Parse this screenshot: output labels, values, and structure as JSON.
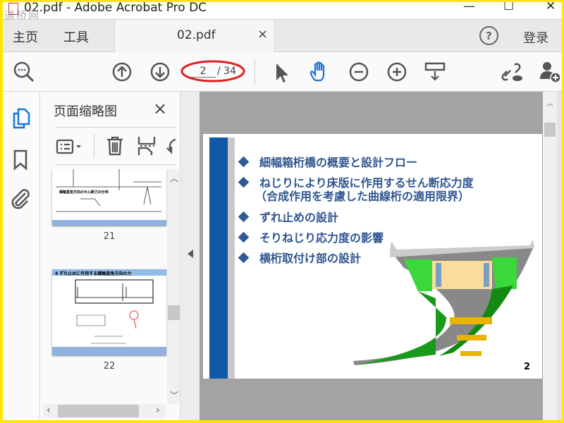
{
  "window": {
    "title": "02.pdf - Adobe Acrobat Pro DC",
    "watermark": "道桥网",
    "minimize": "—",
    "maximize": "☐",
    "close": "✕"
  },
  "tabs": {
    "home": "主页",
    "tools": "工具",
    "document": "02.pdf",
    "document_close": "×",
    "help": "?",
    "signin": "登录"
  },
  "toolbar": {
    "current_page": "2",
    "total_pages": "/ 34",
    "icons": [
      "zoom-search-icon",
      "page-up-icon",
      "page-down-icon",
      "select-arrow-icon",
      "hand-icon",
      "zoom-out-icon",
      "zoom-in-icon",
      "keyboard-icon",
      "share-link-icon",
      "add-user-icon"
    ],
    "hand_color": "#1a73d9",
    "annotation_color": "#e02020"
  },
  "panel": {
    "title": "页面缩略图",
    "close": "×",
    "thumbnails": [
      {
        "label": "21",
        "heading": "横軸直角方向のせん断力の分布"
      },
      {
        "label": "22",
        "heading": "4 ずれ止めに作用する橋軸直角方向の力"
      }
    ]
  },
  "slide": {
    "page_number": "2",
    "bullets": [
      "細幅箱桁橋の概要と設計フロー",
      "ねじりにより床版に作用するせん断応力度",
      "ずれ止めの設計",
      "そりねじり応力度の影響",
      "横桁取付け部の設計"
    ],
    "bullet2_cont": "（合成作用を考慮した曲線桁の適用限界）",
    "accent": "#1158a8",
    "text_color": "#2f5590"
  }
}
